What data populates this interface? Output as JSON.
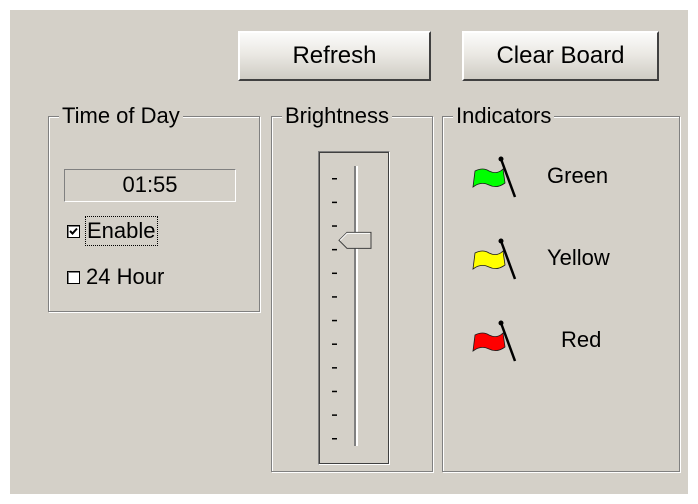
{
  "toolbar": {
    "refresh_label": "Refresh",
    "clear_board_label": "Clear Board"
  },
  "time_of_day": {
    "title": "Time of Day",
    "time_value": "01:55",
    "enable_label": "Enable",
    "enable_checked": true,
    "hour24_label": "24 Hour",
    "hour24_checked": false
  },
  "brightness": {
    "title": "Brightness",
    "tick_count": 12,
    "level": 0.24
  },
  "indicators": {
    "title": "Indicators",
    "items": [
      {
        "label": "Green",
        "color": "#00ff00",
        "icon": "flag-icon"
      },
      {
        "label": "Yellow",
        "color": "#ffff00",
        "icon": "flag-icon"
      },
      {
        "label": "Red",
        "color": "#ff0000",
        "icon": "flag-icon"
      }
    ]
  },
  "colors": {
    "panel_bg": "#d4d0c8",
    "page_bg": "#ffffff"
  }
}
